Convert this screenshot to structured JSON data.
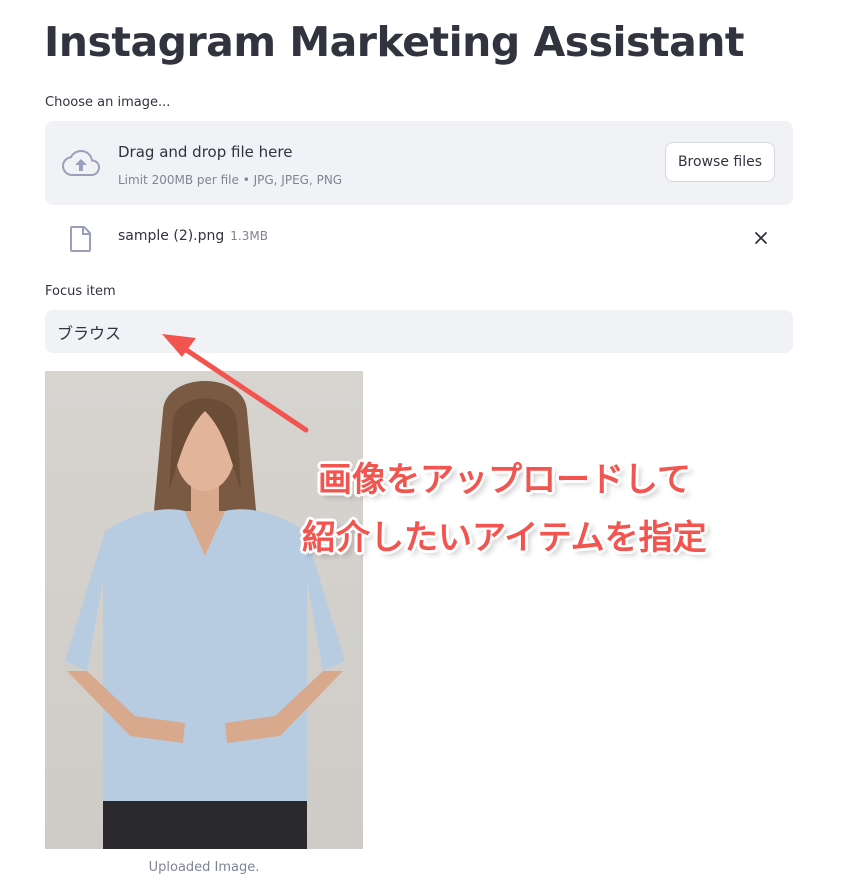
{
  "app": {
    "title": "Instagram Marketing Assistant"
  },
  "uploader": {
    "label": "Choose an image...",
    "drop_title": "Drag and drop file here",
    "drop_limit": "Limit 200MB per file • JPG, JPEG, PNG",
    "browse_label": "Browse files"
  },
  "uploaded_file": {
    "name": "sample (2).png",
    "size": "1.3MB"
  },
  "focus": {
    "label": "Focus item",
    "value": "ブラウス"
  },
  "image": {
    "caption": "Uploaded Image."
  },
  "annotation": {
    "line1": "画像をアップロードして",
    "line2": "紹介したいアイテムを指定"
  },
  "colors": {
    "accent": "#f2544f",
    "input_bg": "#f0f2f6",
    "muted": "#808495",
    "text": "#31333f"
  }
}
